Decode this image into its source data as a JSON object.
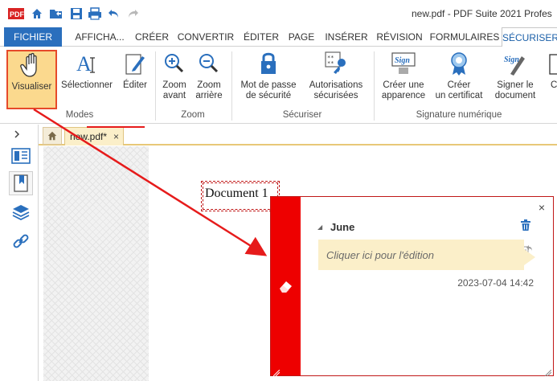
{
  "title_bar": {
    "title": "new.pdf   -   PDF Suite 2021 Profes"
  },
  "menu": {
    "tabs": [
      "FICHIER",
      "AFFICHA...",
      "CRÉER",
      "CONVERTIR",
      "ÉDITER",
      "PAGE",
      "INSÉRER",
      "RÉVISION",
      "FORMULAIRES",
      "SÉCURISER"
    ],
    "active_tab": "SÉCURISER"
  },
  "ribbon": {
    "modes": {
      "label": "Modes",
      "visualiser": "Visualiser",
      "selectionner": "Sélectionner",
      "editer": "Éditer"
    },
    "zoom": {
      "label": "Zoom",
      "zoom_in": "Zoom\navant",
      "zoom_out": "Zoom\narrière"
    },
    "securiser": {
      "label": "Sécuriser",
      "password": "Mot de passe\nde sécurité",
      "permissions": "Autorisations\nsécurisées"
    },
    "signature": {
      "label": "Signature numérique",
      "create_appearance": "Créer une\napparence",
      "create_certificate": "Créer\nun certificat",
      "sign_document": "Signer le\ndocument",
      "cut_label": "C"
    }
  },
  "doc_tab": {
    "name": "new.pdf*",
    "close": "×"
  },
  "document": {
    "field_text": "Document 1"
  },
  "comment": {
    "author": "June",
    "placeholder": "Cliquer ici pour l'édition",
    "date": "2023-07-04 14:42",
    "close": "×",
    "bar_color": "#ee0000"
  },
  "colors": {
    "accent": "#2a6fbd",
    "highlight": "#fbd98e",
    "annotation_red": "#e61b1b"
  }
}
